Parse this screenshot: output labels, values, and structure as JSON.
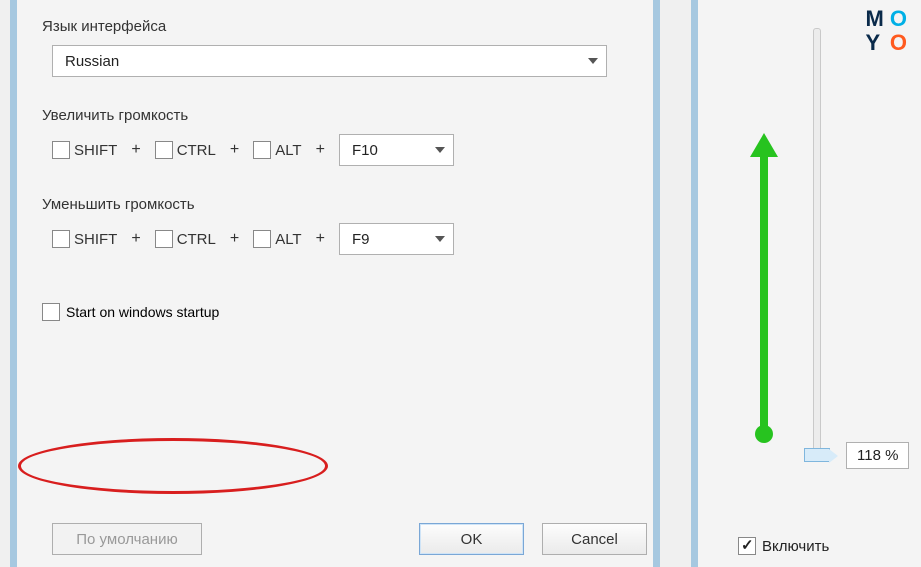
{
  "labels": {
    "language_section": "Язык интерфейса",
    "increase_section": "Увеличить громкость",
    "decrease_section": "Уменьшить громкость",
    "startup": "Start on windows startup",
    "default_btn": "По умолчанию",
    "ok_btn": "OK",
    "cancel_btn": "Cancel",
    "enable": "Включить"
  },
  "language_select": "Russian",
  "modifiers": {
    "shift": "SHIFT",
    "ctrl": "CTRL",
    "alt": "ALT",
    "plus": "+"
  },
  "increase_key": "F10",
  "decrease_key": "F9",
  "slider_percent": "118 %",
  "logo": {
    "m": "M",
    "o1": "O",
    "y": "Y",
    "o2": "O"
  }
}
